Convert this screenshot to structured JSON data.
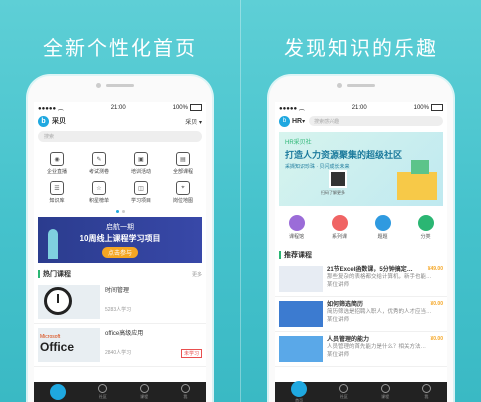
{
  "left": {
    "headline": "全新个性化首页",
    "status": {
      "time": "21:00",
      "battery": "100%"
    },
    "app_title": "采贝",
    "location": "采贝",
    "search_placeholder": "搜索",
    "grid": [
      {
        "label": "企业直播",
        "icon": "live-icon"
      },
      {
        "label": "考试测卷",
        "icon": "exam-icon"
      },
      {
        "label": "培训活动",
        "icon": "training-icon"
      },
      {
        "label": "全部课程",
        "icon": "courses-icon"
      },
      {
        "label": "知识库",
        "icon": "knowledge-icon"
      },
      {
        "label": "积星榜单",
        "icon": "ranking-icon"
      },
      {
        "label": "学习项目",
        "icon": "project-icon"
      },
      {
        "label": "岗位地图",
        "icon": "map-icon"
      }
    ],
    "banner": {
      "line1": "启航一期",
      "line2": "10周线上课程学习项目",
      "button": "点击参与"
    },
    "section": {
      "title": "热门课程",
      "more": "更多"
    },
    "courses": [
      {
        "title": "时间管理",
        "count": "5283人学习",
        "tag": ""
      },
      {
        "title": "office高级应用",
        "count": "2840人学习",
        "tag": "未学习",
        "logo_top": "Microsoft",
        "logo": "Office"
      }
    ],
    "tabs": [
      "首页",
      "社区",
      "课程",
      "我"
    ]
  },
  "right": {
    "headline": "发现知识的乐趣",
    "status": {
      "time": "21:00",
      "battery": "100%"
    },
    "app_title": "HR",
    "search_placeholder": "搜索感兴趣",
    "banner": {
      "line1": "HR采贝社",
      "line2": "打造人力资源聚集的超级社区",
      "line3": "采撷知识珍珠 · 贝闪成长未来",
      "qr_text": "扫码了解更多"
    },
    "cats": [
      {
        "label": "课程馆",
        "color": "#9b6cd8"
      },
      {
        "label": "系列课",
        "color": "#f06464"
      },
      {
        "label": "题题",
        "color": "#2f9ae0"
      },
      {
        "label": "分类",
        "color": "#2bb673"
      }
    ],
    "section": {
      "title": "推荐课程"
    },
    "courses": [
      {
        "title": "21节Excel函数课，5分钟搞定…",
        "desc": "那些复杂的表格都交给计算机，新手也能…",
        "author": "某位讲师",
        "price": "¥49.00"
      },
      {
        "title": "如何筛选简历",
        "desc": "简历筛选是招聘入职人，优秀的人才应当…",
        "author": "某位讲师",
        "price": "¥0.00"
      },
      {
        "title": "人员管理的能力",
        "desc": "人员管理的首先能力是什么？相关方法…",
        "author": "某位讲师",
        "price": "¥0.00"
      }
    ],
    "tabs": [
      "首页",
      "社区",
      "课程",
      "我"
    ]
  }
}
